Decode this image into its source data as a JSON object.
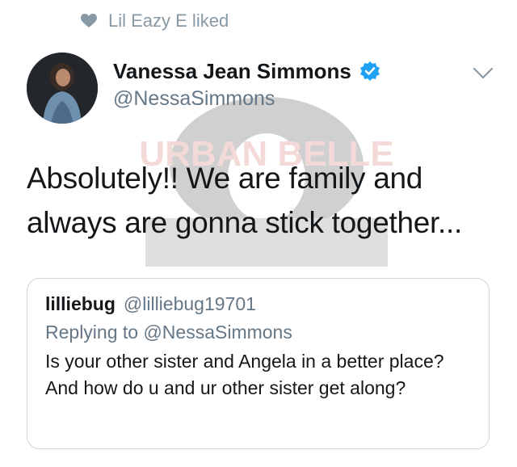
{
  "social_context": {
    "text": "Lil Eazy E liked",
    "icon": "heart-icon"
  },
  "tweet": {
    "author": {
      "name": "Vanessa Jean Simmons",
      "handle": "@NessaSimmons",
      "verified": true,
      "avatar_icon": "avatar"
    },
    "text": "Absolutely!! We are family and always are gonna stick together..."
  },
  "watermark": {
    "text": "URBAN BELLE"
  },
  "quoted_tweet": {
    "name": "lilliebug",
    "handle": "@lilliebug19701",
    "replying_to": "Replying to @NessaSimmons",
    "text": "Is your other sister and Angela in a better place? And how do u and ur other sister get along?"
  },
  "colors": {
    "text": "#14171a",
    "secondary": "#657786",
    "muted": "#8899a6",
    "verified": "#1da1f2",
    "border": "#ccd6dd",
    "watermark": "#c0392b"
  }
}
